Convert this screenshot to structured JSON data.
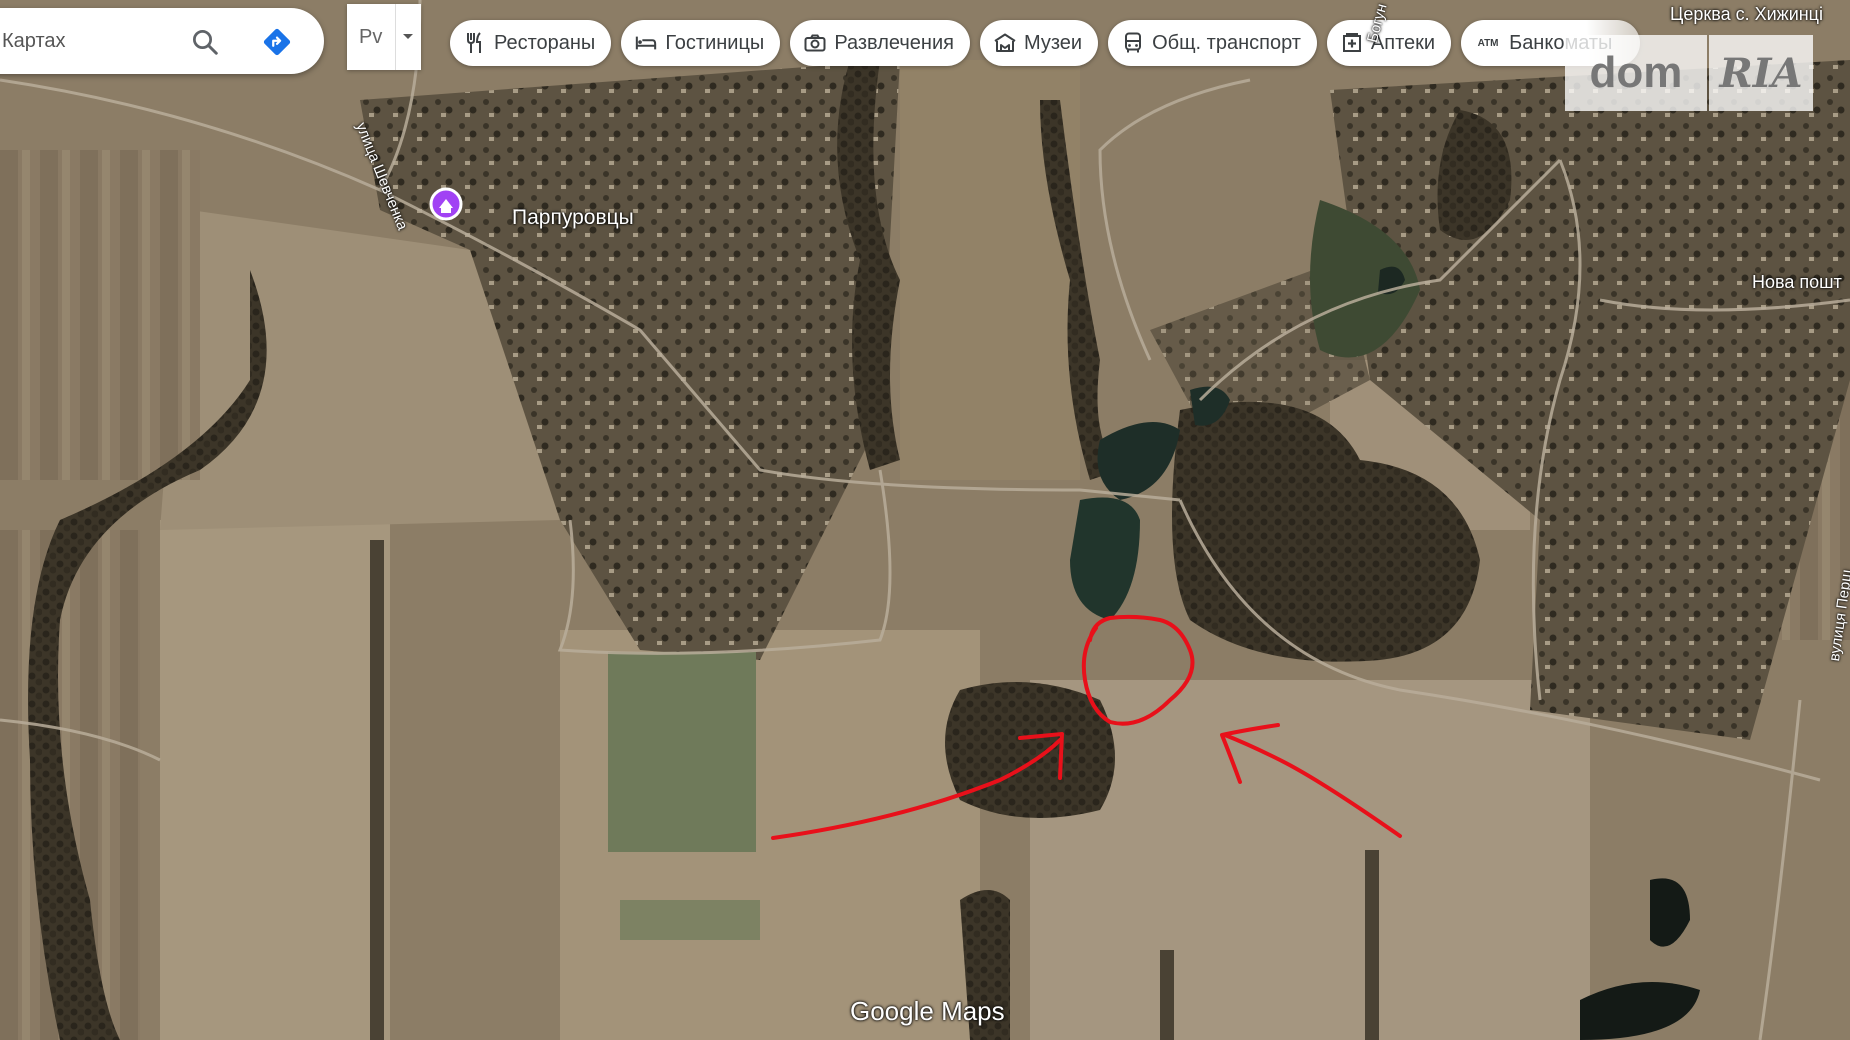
{
  "search": {
    "value": "Картах"
  },
  "layer_select": {
    "label": "Рv"
  },
  "chips": [
    {
      "icon": "fork-knife-icon",
      "label": "Рестораны"
    },
    {
      "icon": "bed-icon",
      "label": "Гостиницы"
    },
    {
      "icon": "camera-icon",
      "label": "Развлечения"
    },
    {
      "icon": "museum-icon",
      "label": "Музеи"
    },
    {
      "icon": "bus-icon",
      "label": "Общ. транспорт"
    },
    {
      "icon": "pharmacy-icon",
      "label": "Аптеки"
    },
    {
      "icon": "atm-icon",
      "icon_text": "ATM",
      "label": "Банкоматы"
    }
  ],
  "watermark": {
    "dom": "dom",
    "ria": "RIA"
  },
  "map_labels": {
    "village": "Парпуровцы",
    "street_shevchenka": "улица Шевченка",
    "church": "Церква с. Хижинці",
    "nova_post": "Нова пошт",
    "street_persh": "вулиця Перш",
    "street_top": "Богун"
  },
  "attribution": "Google Maps",
  "colors": {
    "annotation": "#e8101a",
    "chip_text": "#3c4043",
    "directions": "#1a73e8",
    "pin": "#a142f4"
  }
}
